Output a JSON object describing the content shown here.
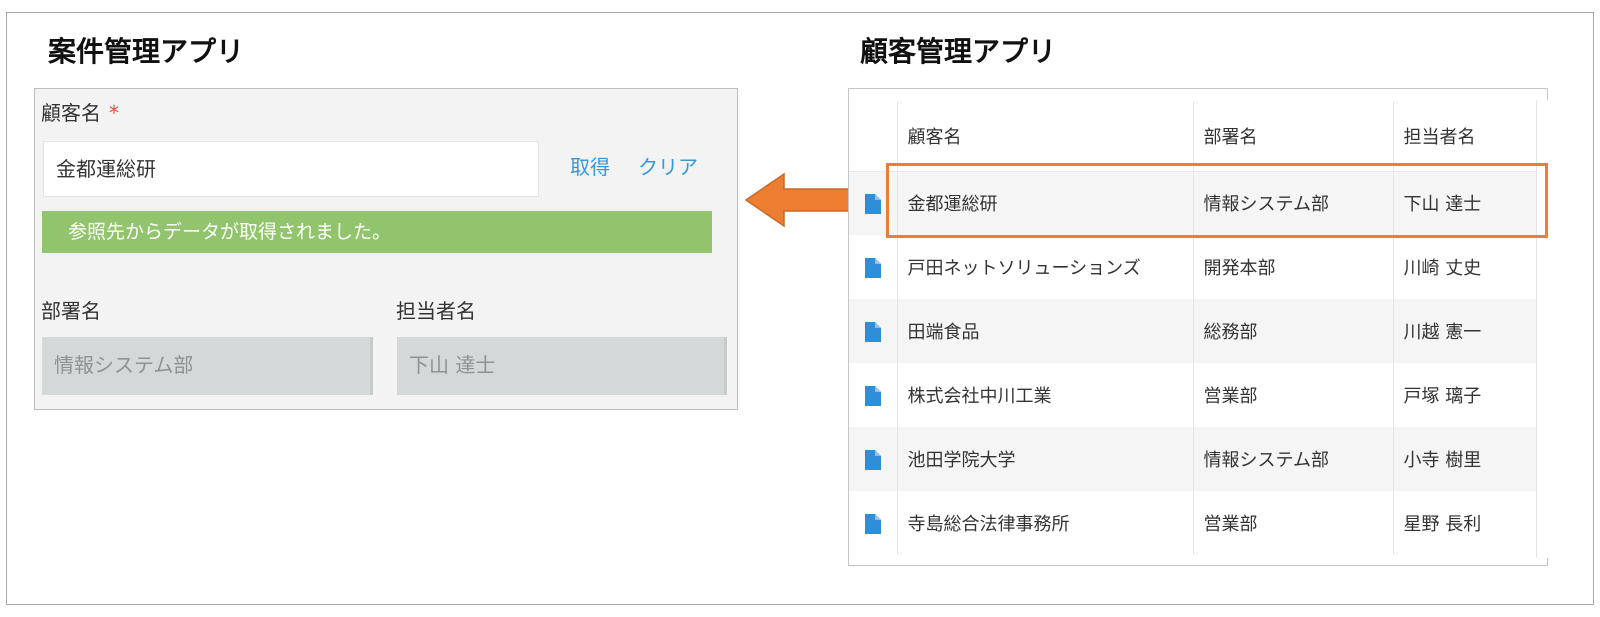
{
  "left_app": {
    "title": "案件管理アプリ",
    "customer_field": {
      "label": "顧客名",
      "required_mark": "*",
      "value": "金都運総研"
    },
    "actions": {
      "fetch": "取得",
      "clear": "クリア"
    },
    "success_message": "参照先からデータが取得されました。",
    "department": {
      "label": "部署名",
      "value": "情報システム部"
    },
    "person": {
      "label": "担当者名",
      "value": "下山 達士"
    }
  },
  "right_app": {
    "title": "顧客管理アプリ",
    "columns": [
      "顧客名",
      "部署名",
      "担当者名"
    ],
    "rows": [
      [
        "金都運総研",
        "情報システム部",
        "下山 達士"
      ],
      [
        "戸田ネットソリューションズ",
        "開発本部",
        "川崎 丈史"
      ],
      [
        "田端食品",
        "総務部",
        "川越 憲一"
      ],
      [
        "株式会社中川工業",
        "営業部",
        "戸塚 璃子"
      ],
      [
        "池田学院大学",
        "情報システム部",
        "小寺 樹里"
      ],
      [
        "寺島総合法律事務所",
        "営業部",
        "星野 長利"
      ]
    ],
    "highlighted_row": 0
  },
  "icons": {
    "record": "document-icon",
    "transfer": "left-arrow-icon"
  },
  "colors": {
    "link": "#3498db",
    "success": "#91c46c",
    "required": "#e74c3c",
    "highlight": "#ed7d31",
    "doc_icon": "#2e8fd6"
  }
}
